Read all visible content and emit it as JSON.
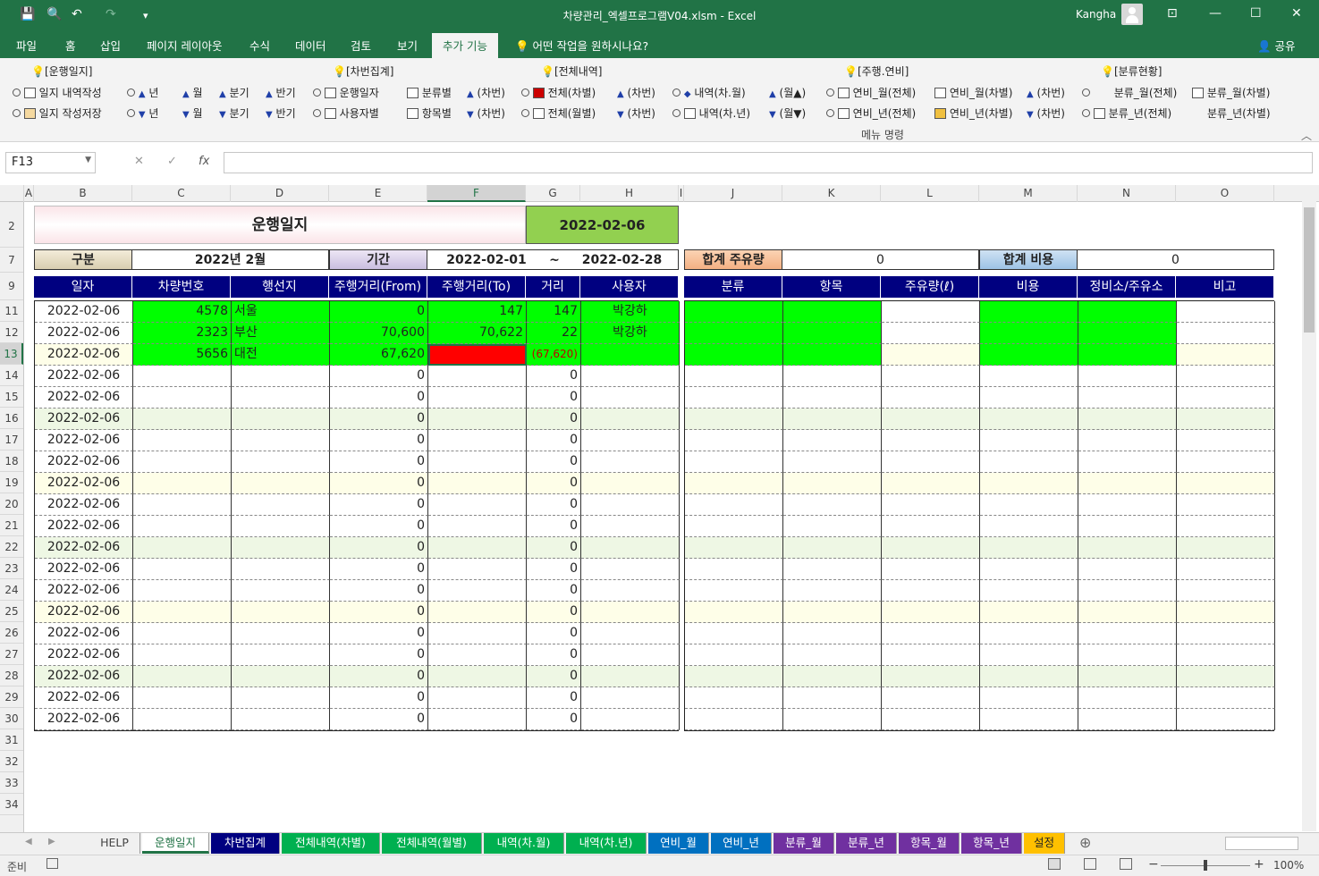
{
  "window": {
    "title": "차량관리_엑셀프로그램V04.xlsm  -  Excel",
    "user": "Kangha",
    "restore_glyph": "⧉",
    "minimize_glyph": "—",
    "maximize_glyph": "☐",
    "close_glyph": "✕",
    "ribbon_display_glyph": "⊡"
  },
  "quick_access": {
    "save": "💾",
    "preview": "🔍",
    "undo": "↶",
    "redo": "↷",
    "more": "▾"
  },
  "ribbon_tabs": [
    "파일",
    "홈",
    "삽입",
    "페이지 레이아웃",
    "수식",
    "데이터",
    "검토",
    "보기",
    "추가 기능"
  ],
  "active_tab": "추가 기능",
  "tell_me": "어떤 작업을 원하시나요?",
  "share": "공유",
  "ribbon": {
    "group_label": "메뉴 명령",
    "bulb": "💡",
    "headers": [
      "[운행일지]",
      "[차번집계]",
      "[전체내역]",
      "[주행.연비]",
      "[분류현황]"
    ],
    "row1": [
      "일지 내역작성",
      "년",
      "월",
      "분기",
      "반기",
      "운행일자",
      "분류별",
      "(차번)",
      "전체(차별)",
      "(차번)",
      "내역(차.월)",
      "(월▲)",
      "연비_월(전체)",
      "연비_월(차별)",
      "(차번)",
      "분류_월(전체)",
      "분류_월(차별)"
    ],
    "row2": [
      "일지 작성저장",
      "년",
      "월",
      "분기",
      "반기",
      "사용자별",
      "항목별",
      "(차번)",
      "전체(월별)",
      "(차번)",
      "내역(차.년)",
      "(월▼)",
      "연비_년(전체)",
      "연비_년(차별)",
      "(차번)",
      "분류_년(전체)",
      "분류_년(차별)"
    ],
    "up": "▲",
    "down": "▼"
  },
  "formula_bar": {
    "name_box": "F13",
    "cancel": "✕",
    "enter": "✓",
    "fx": "fx",
    "formula": ""
  },
  "columns": [
    "A",
    "B",
    "C",
    "D",
    "E",
    "F",
    "G",
    "H",
    "I",
    "J",
    "K",
    "L",
    "M",
    "N",
    "O"
  ],
  "selected_column": "F",
  "rows": [
    "2",
    "7",
    "9",
    "11",
    "12",
    "13",
    "14",
    "15",
    "16",
    "17",
    "18",
    "19",
    "20",
    "21",
    "22",
    "23",
    "24",
    "25",
    "26",
    "27",
    "28",
    "29",
    "30",
    "31",
    "32",
    "33",
    "34"
  ],
  "selected_row": "13",
  "sheet": {
    "title": "운행일지",
    "title_date": "2022-02-06",
    "gubun_label": "구분",
    "gubun_value": "2022년 2월",
    "period_label": "기간",
    "period_from": "2022-02-01",
    "period_tilde": "~",
    "period_to": "2022-02-28",
    "total_fuel_label": "합계 주유량",
    "total_fuel_value": "0",
    "total_cost_label": "합계 비용",
    "total_cost_value": "0",
    "left_headers": [
      "일자",
      "차량번호",
      "행선지",
      "주행거리(From)",
      "주행거리(To)",
      "거리",
      "사용자"
    ],
    "right_headers": [
      "분류",
      "항목",
      "주유량(ℓ)",
      "비용",
      "정비소/주유소",
      "비고"
    ],
    "log_rows": [
      {
        "date": "2022-02-06",
        "car": "4578",
        "dest": "서울",
        "from": "0",
        "to": "147",
        "dist": "147",
        "user": "박강하"
      },
      {
        "date": "2022-02-06",
        "car": "2323",
        "dest": "부산",
        "from": "70,600",
        "to": "70,622",
        "dist": "22",
        "user": "박강하"
      },
      {
        "date": "2022-02-06",
        "car": "5656",
        "dest": "대전",
        "from": "67,620",
        "to": "",
        "dist": "(67,620)",
        "user": ""
      },
      {
        "date": "2022-02-06",
        "car": "",
        "dest": "",
        "from": "0",
        "to": "",
        "dist": "0",
        "user": ""
      },
      {
        "date": "2022-02-06",
        "car": "",
        "dest": "",
        "from": "0",
        "to": "",
        "dist": "0",
        "user": ""
      },
      {
        "date": "2022-02-06",
        "car": "",
        "dest": "",
        "from": "0",
        "to": "",
        "dist": "0",
        "user": ""
      },
      {
        "date": "2022-02-06",
        "car": "",
        "dest": "",
        "from": "0",
        "to": "",
        "dist": "0",
        "user": ""
      },
      {
        "date": "2022-02-06",
        "car": "",
        "dest": "",
        "from": "0",
        "to": "",
        "dist": "0",
        "user": ""
      },
      {
        "date": "2022-02-06",
        "car": "",
        "dest": "",
        "from": "0",
        "to": "",
        "dist": "0",
        "user": ""
      },
      {
        "date": "2022-02-06",
        "car": "",
        "dest": "",
        "from": "0",
        "to": "",
        "dist": "0",
        "user": ""
      },
      {
        "date": "2022-02-06",
        "car": "",
        "dest": "",
        "from": "0",
        "to": "",
        "dist": "0",
        "user": ""
      },
      {
        "date": "2022-02-06",
        "car": "",
        "dest": "",
        "from": "0",
        "to": "",
        "dist": "0",
        "user": ""
      },
      {
        "date": "2022-02-06",
        "car": "",
        "dest": "",
        "from": "0",
        "to": "",
        "dist": "0",
        "user": ""
      },
      {
        "date": "2022-02-06",
        "car": "",
        "dest": "",
        "from": "0",
        "to": "",
        "dist": "0",
        "user": ""
      },
      {
        "date": "2022-02-06",
        "car": "",
        "dest": "",
        "from": "0",
        "to": "",
        "dist": "0",
        "user": ""
      },
      {
        "date": "2022-02-06",
        "car": "",
        "dest": "",
        "from": "0",
        "to": "",
        "dist": "0",
        "user": ""
      },
      {
        "date": "2022-02-06",
        "car": "",
        "dest": "",
        "from": "0",
        "to": "",
        "dist": "0",
        "user": ""
      },
      {
        "date": "2022-02-06",
        "car": "",
        "dest": "",
        "from": "0",
        "to": "",
        "dist": "0",
        "user": ""
      },
      {
        "date": "2022-02-06",
        "car": "",
        "dest": "",
        "from": "0",
        "to": "",
        "dist": "0",
        "user": ""
      },
      {
        "date": "2022-02-06",
        "car": "",
        "dest": "",
        "from": "0",
        "to": "",
        "dist": "0",
        "user": ""
      }
    ]
  },
  "sheet_tabs": [
    {
      "label": "HELP",
      "bg": "#f0f0f0",
      "fg": "#444"
    },
    {
      "label": "운행일지",
      "bg": "#ffffff",
      "fg": "#217346"
    },
    {
      "label": "차번집계",
      "bg": "#000080",
      "fg": "#ffffff"
    },
    {
      "label": "전체내역(차별)",
      "bg": "#00b050",
      "fg": "#ffffff"
    },
    {
      "label": "전체내역(월별)",
      "bg": "#00b050",
      "fg": "#ffffff"
    },
    {
      "label": "내역(차.월)",
      "bg": "#00b050",
      "fg": "#ffffff"
    },
    {
      "label": "내역(차.년)",
      "bg": "#00b050",
      "fg": "#ffffff"
    },
    {
      "label": "연비_월",
      "bg": "#0070c0",
      "fg": "#ffffff"
    },
    {
      "label": "연비_년",
      "bg": "#0070c0",
      "fg": "#ffffff"
    },
    {
      "label": "분류_월",
      "bg": "#7030a0",
      "fg": "#ffffff"
    },
    {
      "label": "분류_년",
      "bg": "#7030a0",
      "fg": "#ffffff"
    },
    {
      "label": "항목_월",
      "bg": "#7030a0",
      "fg": "#ffffff"
    },
    {
      "label": "항목_년",
      "bg": "#7030a0",
      "fg": "#ffffff"
    },
    {
      "label": "설정",
      "bg": "#ffc000",
      "fg": "#222222"
    }
  ],
  "add_sheet": "⊕",
  "status": {
    "ready": "준비",
    "zoom": "100%",
    "minus": "−",
    "plus": "+"
  },
  "colors": {
    "excel_green": "#217346",
    "header_navy": "#000080",
    "row_green": "#00ff00",
    "error_red": "#ff0000",
    "alt_row_yellow": "#fefee8",
    "alt_row_green": "#eef7e4",
    "date_box": "#92d050",
    "fuel_label": "#f4b183",
    "cost_label": "#9dc3e6"
  }
}
